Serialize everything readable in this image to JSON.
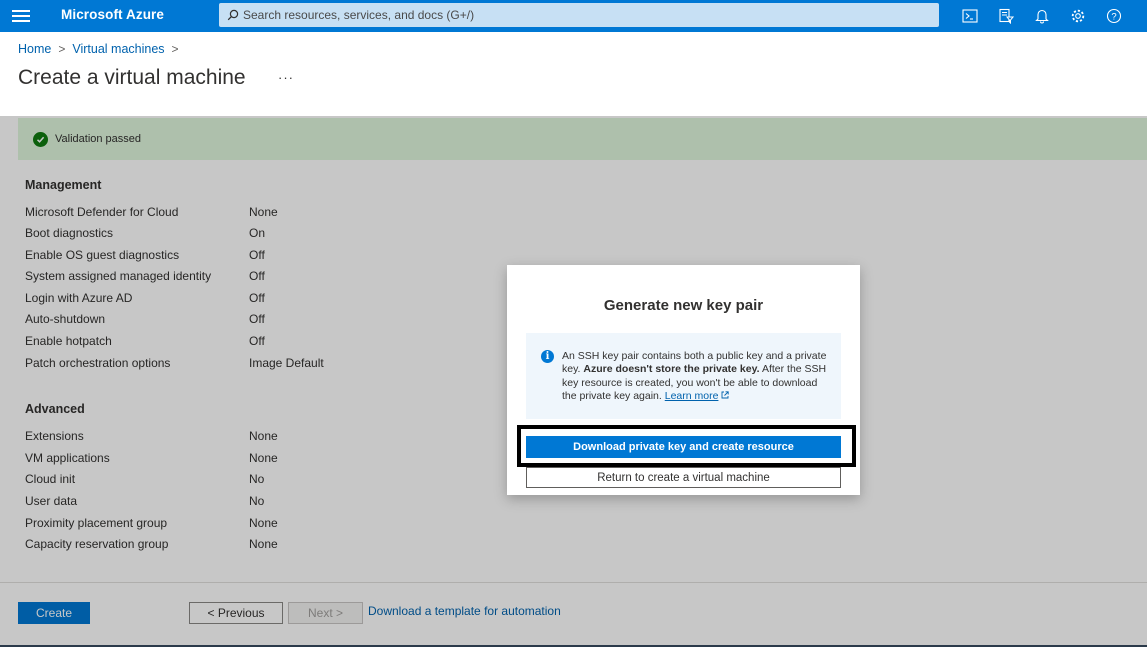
{
  "topbar": {
    "brand": "Microsoft Azure",
    "search_placeholder": "Search resources, services, and docs (G+/)",
    "icons": [
      "cloud-shell-icon",
      "directory-filter-icon",
      "notifications-icon",
      "settings-icon",
      "help-icon"
    ]
  },
  "breadcrumb": {
    "home": "Home",
    "vms": "Virtual machines",
    "separator": ">"
  },
  "page": {
    "title": "Create a virtual machine",
    "more": "···"
  },
  "validation": {
    "text": "Validation passed"
  },
  "management": {
    "title": "Management",
    "rows": [
      {
        "label": "Microsoft Defender for Cloud",
        "value": "None"
      },
      {
        "label": "Boot diagnostics",
        "value": "On"
      },
      {
        "label": "Enable OS guest diagnostics",
        "value": "Off"
      },
      {
        "label": "System assigned managed identity",
        "value": "Off"
      },
      {
        "label": "Login with Azure AD",
        "value": "Off"
      },
      {
        "label": "Auto-shutdown",
        "value": "Off"
      },
      {
        "label": "Enable hotpatch",
        "value": "Off"
      },
      {
        "label": "Patch orchestration options",
        "value": "Image Default"
      }
    ]
  },
  "advanced": {
    "title": "Advanced",
    "rows": [
      {
        "label": "Extensions",
        "value": "None"
      },
      {
        "label": "VM applications",
        "value": "None"
      },
      {
        "label": "Cloud init",
        "value": "No"
      },
      {
        "label": "User data",
        "value": "No"
      },
      {
        "label": "Proximity placement group",
        "value": "None"
      },
      {
        "label": "Capacity reservation group",
        "value": "None"
      }
    ]
  },
  "footer": {
    "create": "Create",
    "previous": "< Previous",
    "next": "Next >",
    "template_link": "Download a template for automation"
  },
  "dialog": {
    "title": "Generate new key pair",
    "info_part1": "An SSH key pair contains both a public key and a private key. ",
    "info_bold": "Azure doesn't store the private key.",
    "info_part2": " After the SSH key resource is created, you won't be able to download the private key again. ",
    "learn_more": "Learn more",
    "download_button": "Download private key and create resource",
    "return_button": "Return to create a virtual machine"
  },
  "colors": {
    "azure_blue": "#0078d4",
    "validation_bg": "#dff6dd",
    "success_green": "#107c10",
    "link": "#0062ad"
  }
}
